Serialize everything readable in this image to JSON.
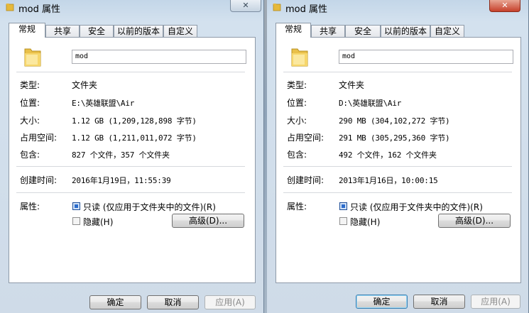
{
  "windows": [
    {
      "title": "mod 属性",
      "close_glyph": "✕",
      "tabs": [
        {
          "label": "常规",
          "active": true
        },
        {
          "label": "共享",
          "active": false
        },
        {
          "label": "安全",
          "active": false
        },
        {
          "label": "以前的版本",
          "active": false
        },
        {
          "label": "自定义",
          "active": false
        }
      ],
      "name": "mod",
      "rows": [
        {
          "label": "类型:",
          "value": "文件夹"
        },
        {
          "label": "位置:",
          "value": "E:\\英雄联盟\\Air"
        },
        {
          "label": "大小:",
          "value": "1.12 GB (1,209,128,898 字节)"
        },
        {
          "label": "占用空间:",
          "value": "1.12 GB (1,211,011,072 字节)"
        },
        {
          "label": "包含:",
          "value": "827 个文件，357 个文件夹"
        }
      ],
      "created_label": "创建时间:",
      "created_value": "2016年1月19日，11:55:39",
      "attributes_label": "属性:",
      "readonly_label": "只读 (仅应用于文件夹中的文件)(R)",
      "hidden_label": "隐藏(H)",
      "advanced_label": "高级(D)...",
      "ok_label": "确定",
      "cancel_label": "取消",
      "apply_label": "应用(A)"
    },
    {
      "title": "mod 属性",
      "close_glyph": "✕",
      "tabs": [
        {
          "label": "常规",
          "active": true
        },
        {
          "label": "共享",
          "active": false
        },
        {
          "label": "安全",
          "active": false
        },
        {
          "label": "以前的版本",
          "active": false
        },
        {
          "label": "自定义",
          "active": false
        }
      ],
      "name": "mod",
      "rows": [
        {
          "label": "类型:",
          "value": "文件夹"
        },
        {
          "label": "位置:",
          "value": "D:\\英雄联盟\\Air"
        },
        {
          "label": "大小:",
          "value": "290 MB (304,102,272 字节)"
        },
        {
          "label": "占用空间:",
          "value": "291 MB (305,295,360 字节)"
        },
        {
          "label": "包含:",
          "value": "492 个文件，162 个文件夹"
        }
      ],
      "created_label": "创建时间:",
      "created_value": "2013年1月16日，10:00:15",
      "attributes_label": "属性:",
      "readonly_label": "只读 (仅应用于文件夹中的文件)(R)",
      "hidden_label": "隐藏(H)",
      "advanced_label": "高级(D)...",
      "ok_label": "确定",
      "cancel_label": "取消",
      "apply_label": "应用(A)"
    }
  ],
  "colors": {
    "folder": "#f2c94c",
    "checkbox_checked": "#2b6ccc",
    "close_active": "#c6402a"
  }
}
